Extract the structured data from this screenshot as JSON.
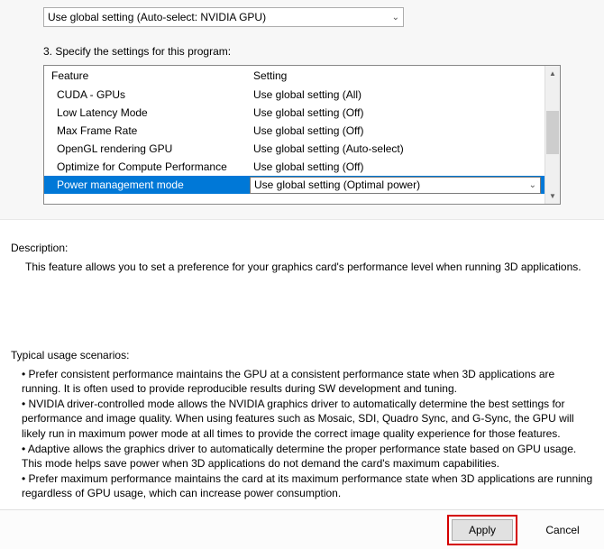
{
  "topDropdown": {
    "value": "Use global setting (Auto-select: NVIDIA GPU)"
  },
  "step3Label": "3. Specify the settings for this program:",
  "headers": {
    "feature": "Feature",
    "setting": "Setting"
  },
  "rows": [
    {
      "feature": "CUDA - GPUs",
      "setting": "Use global setting (All)"
    },
    {
      "feature": "Low Latency Mode",
      "setting": "Use global setting (Off)"
    },
    {
      "feature": "Max Frame Rate",
      "setting": "Use global setting (Off)"
    },
    {
      "feature": "OpenGL rendering GPU",
      "setting": "Use global setting (Auto-select)"
    },
    {
      "feature": "Optimize for Compute Performance",
      "setting": "Use global setting (Off)"
    }
  ],
  "selectedRow": {
    "feature": "Power management mode",
    "setting": "Use global setting (Optimal power)"
  },
  "descriptionLabel": "Description:",
  "descriptionText": "This feature allows you to set a preference for your graphics card's performance level when running 3D applications.",
  "scenariosLabel": "Typical usage scenarios:",
  "bullets": [
    "• Prefer consistent performance maintains the GPU at a consistent performance state when 3D applications are running. It is often used to provide reproducible results during SW development and tuning.",
    "• NVIDIA driver-controlled mode allows the NVIDIA graphics driver to automatically determine the best settings for performance and image quality. When using features such as Mosaic, SDI, Quadro Sync, and G-Sync, the GPU will likely run in maximum power mode at all times to provide the correct image quality experience for those features.",
    "• Adaptive allows the graphics driver to automatically determine the proper performance state based on GPU usage. This mode helps save power when 3D applications do not demand the card's maximum capabilities.",
    "• Prefer maximum performance maintains the card at its maximum performance state when 3D applications are running regardless of GPU usage, which can increase power consumption."
  ],
  "applyLabel": "Apply",
  "cancelLabel": "Cancel"
}
